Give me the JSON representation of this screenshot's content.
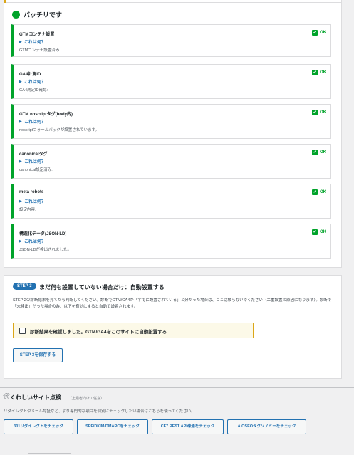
{
  "status_heading": "バッチリです",
  "checks": [
    {
      "title": "GTMコンテナ設置",
      "status": "OK",
      "details_label": "これは何？",
      "note": "GTMコンテナ設置済み"
    },
    {
      "title": "GA4計測ID",
      "status": "OK",
      "details_label": "これは何？",
      "note": "GA4測定ID確認:"
    },
    {
      "title": "GTM noscriptタグ(body内)",
      "status": "OK",
      "details_label": "これは何？",
      "note": "noscriptフォールバックが設置されています。"
    },
    {
      "title": "canonicalタグ",
      "status": "OK",
      "details_label": "これは何？",
      "note": "canonical設定済み:"
    },
    {
      "title": "meta robots",
      "status": "OK",
      "details_label": "これは何？",
      "note": "設定内容:"
    },
    {
      "title": "構造化データ(JSON-LD)",
      "status": "OK",
      "details_label": "これは何？",
      "note": "JSON-LDが検出されました。"
    }
  ],
  "step3": {
    "badge": "STEP 3",
    "title": "まだ何も設置していない場合だけ：自動設置する",
    "description": "STEP 2の診断結果を見てから判断してください。診断でGTM/GA4が「すでに設置されている」と分かった場合は、ここは触らないでください（二重設置の原因になります）。診断で「未検出」だった場合のみ、以下を有効にすると自動で設置されます。",
    "confirm_label": "診断結果を確認しました。GTM/GA4をこのサイトに自動設置する",
    "save_label": "STEP 3を保存する"
  },
  "detail_check": {
    "title": "くわしいサイト点検",
    "subtitle": "（上級者向け・任意）",
    "description": "リダイレクトやメール認証など、より専門的な項目を個別にチェックしたい場合はこちらを使ってください。",
    "buttons": [
      "301リダイレクトをチェック",
      "SPF/DKIM/DMARCをチェック",
      "CF7 REST API疎通をチェック",
      "AIOSEOタクソノミーをチェック"
    ]
  },
  "colors": {
    "ok": "#00a32a",
    "link": "#2271b1",
    "warning_border": "#dba617",
    "warning_bg": "#fcf9e8"
  },
  "icons": {
    "status": "green-dot-icon",
    "check": "checkmark-box-icon",
    "expand": "triangle-right-icon",
    "tools": "wrench-icon"
  }
}
